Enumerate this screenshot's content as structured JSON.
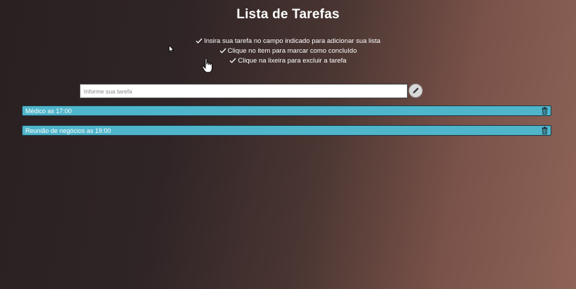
{
  "app": {
    "title": "Lista de Tarefas"
  },
  "instructions": [
    {
      "icon": "check-icon",
      "text": "Insira sua tarefa no campo indicado para adicionar sua lista"
    },
    {
      "icon": "check-icon",
      "text": "Clique no item para marcar como concluído"
    },
    {
      "icon": "check-icon",
      "text": "Clique na lixeira para excluir a tarefa"
    }
  ],
  "form": {
    "input_value": "",
    "placeholder": "Informe sua tarefa",
    "add_icon": "pencil-icon"
  },
  "tasks": [
    {
      "label": "Médico as 17:00",
      "icon": "trash-icon"
    },
    {
      "label": "Reunião de negócios as 19:00",
      "icon": "trash-icon"
    }
  ],
  "colors": {
    "task_background": "#4fb5cb",
    "task_border": "#1d3a44",
    "background_dark": "#2a2022",
    "background_light": "#8e6457"
  }
}
